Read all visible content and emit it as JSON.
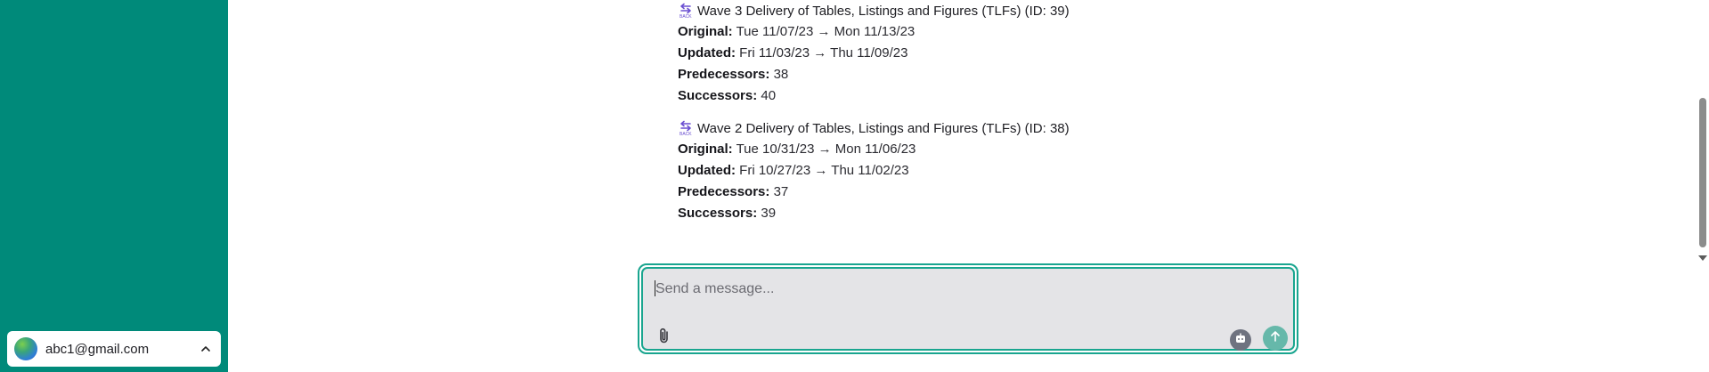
{
  "user": {
    "email": "abc1@gmail.com"
  },
  "icons": {
    "task_icon": "back-arrow-icon",
    "user_menu_icon": "chevron-up-icon",
    "attach_icon": "paperclip-icon",
    "bot_icon": "robot-icon",
    "send_icon": "arrow-up-icon"
  },
  "colors": {
    "sidebar": "#008a7a",
    "accent": "#19a58f",
    "send_button": "#66b8aa"
  },
  "tasks": [
    {
      "title": "Wave 3 Delivery of Tables, Listings and Figures (TLFs) (ID: 39)",
      "original_label": "Original:",
      "original_value": "Tue 11/07/23 → Mon 11/13/23",
      "updated_label": "Updated:",
      "updated_value": "Fri 11/03/23 → Thu 11/09/23",
      "predecessors_label": "Predecessors:",
      "predecessors_value": "38",
      "successors_label": "Successors:",
      "successors_value": "40"
    },
    {
      "title": "Wave 2 Delivery of Tables, Listings and Figures (TLFs) (ID: 38)",
      "original_label": "Original:",
      "original_value": "Tue 10/31/23 → Mon 11/06/23",
      "updated_label": "Updated:",
      "updated_value": "Fri 10/27/23 → Thu 11/02/23",
      "predecessors_label": "Predecessors:",
      "predecessors_value": "37",
      "successors_label": "Successors:",
      "successors_value": "39"
    }
  ],
  "composer": {
    "placeholder": "Send a message..."
  }
}
